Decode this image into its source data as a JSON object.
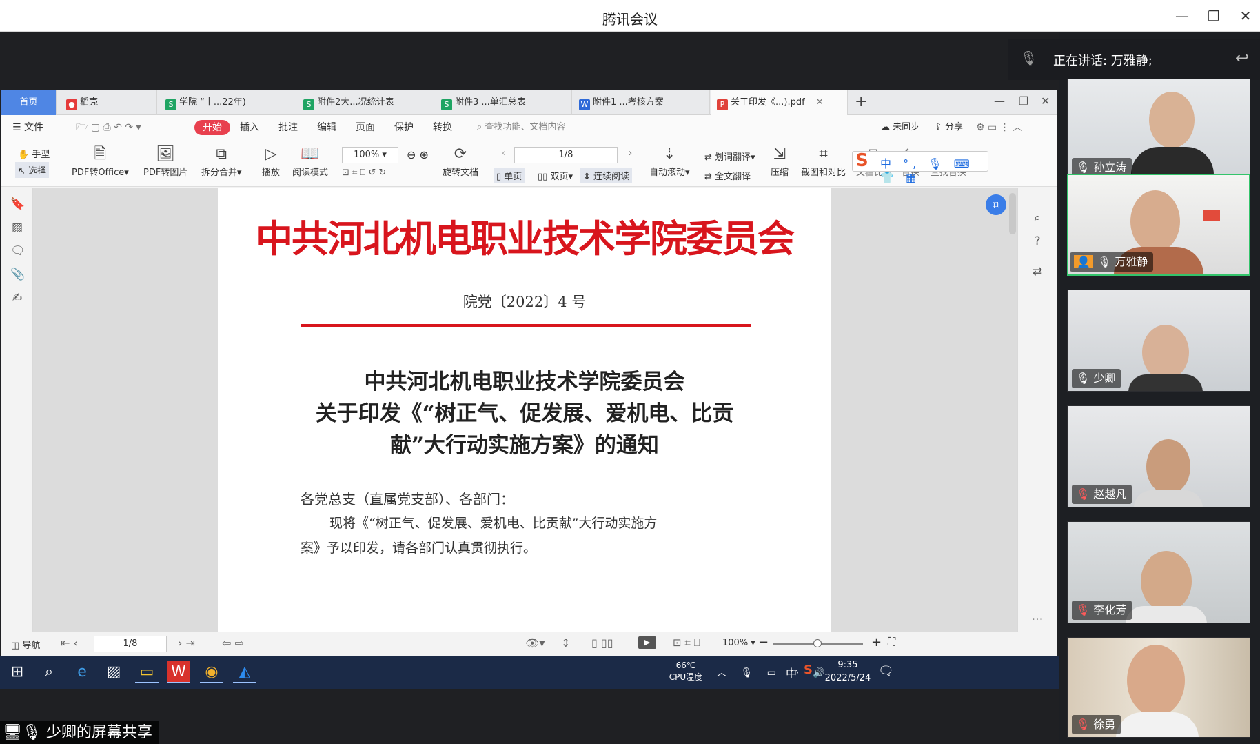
{
  "meeting": {
    "title": "腾讯会议",
    "speaking": "正在讲话: 万雅静;",
    "share_label": "少卿的屏幕共享"
  },
  "wps": {
    "tabs": [
      {
        "label": "首页"
      },
      {
        "label": "稻壳"
      },
      {
        "label": "学院 “十...22年)"
      },
      {
        "label": "附件2大...况统计表"
      },
      {
        "label": "附件3 ...单汇总表"
      },
      {
        "label": "附件1 ...考核方案"
      },
      {
        "label": "关于印发《...).pdf"
      }
    ],
    "menu": {
      "file": "文件",
      "start": "开始",
      "items": [
        "插入",
        "批注",
        "编辑",
        "页面",
        "保护",
        "转换"
      ],
      "search": "查找功能、文档内容",
      "sync": "未同步",
      "share": "分享"
    },
    "toolbar": {
      "hand": "手型",
      "select": "选择",
      "pdf_to_office": "PDF转Office",
      "pdf_to_image": "PDF转图片",
      "split_merge": "拆分合并",
      "play": "播放",
      "read_mode": "阅读模式",
      "zoom": "100%",
      "page": "1/8",
      "rotate": "旋转文档",
      "single": "单页",
      "double": "双页",
      "continuous": "连续阅读",
      "auto_scroll": "自动滚动",
      "word_translate": "划词翻译",
      "full_translate": "全文翻译",
      "compress": "压缩",
      "screenshot_compare": "截图和对比",
      "doc_compare": "文档比对",
      "replace": "替换",
      "find_replace": "查找替换"
    },
    "document": {
      "header": "中共河北机电职业技术学院委员会",
      "doc_number": "院党〔2022〕4 号",
      "title_line1": "中共河北机电职业技术学院委员会",
      "title_line2": "关于印发《“树正气、促发展、爱机电、比贡",
      "title_line3": "献”大行动实施方案》的通知",
      "salutation": "各党总支（直属党支部）、各部门：",
      "body_line1": "现将《“树正气、促发展、爱机电、比贡献”大行动实施方",
      "body_line2": "案》予以印发，请各部门认真贯彻执行。"
    },
    "status": {
      "nav": "导航",
      "page": "1/8",
      "zoom": "100%"
    }
  },
  "taskbar": {
    "temp": "66℃",
    "temp_label": "CPU温度",
    "ime": "中",
    "time": "9:35",
    "date": "2022/5/24"
  },
  "participants": [
    {
      "name": "孙立涛"
    },
    {
      "name": "万雅静"
    },
    {
      "name": "少卿"
    },
    {
      "name": "赵越凡"
    },
    {
      "name": "李化芳"
    },
    {
      "name": "徐勇"
    }
  ]
}
